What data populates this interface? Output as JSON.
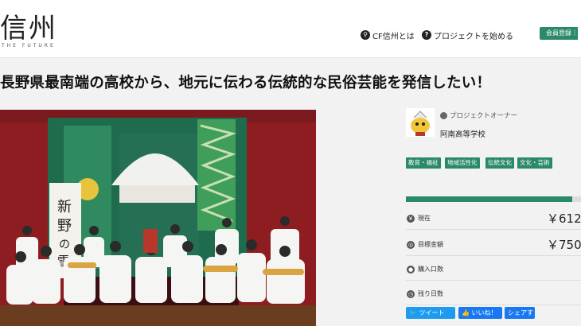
{
  "header": {
    "logo_text": "信州",
    "logo_tagline": "THE FUTURE",
    "nav": [
      {
        "label": "CF信州とは",
        "icon": "search-icon"
      },
      {
        "label": "プロジェクトを始める",
        "icon": "question-icon"
      }
    ],
    "register_label": "会員登録｜"
  },
  "project": {
    "title": "長野県最南端の高校から、地元に伝わる伝統的な民俗芸能を発信したい！",
    "hero_banner_text": "新野の雪ま"
  },
  "owner": {
    "label": "プロジェクトオーナー",
    "name": "阿南高等学校"
  },
  "tags": [
    "教育・福祉",
    "地域活性化",
    "伝統文化",
    "文化・芸術"
  ],
  "progress": {
    "fraction": 0.95
  },
  "stats": [
    {
      "label": "現在",
      "value": "￥612",
      "icon": "yen-icon"
    },
    {
      "label": "目標金額",
      "value": "￥750",
      "icon": "target-icon"
    },
    {
      "label": "購入口数",
      "value": "",
      "icon": "people-icon"
    },
    {
      "label": "残り日数",
      "value": "",
      "icon": "clock-icon"
    }
  ],
  "share": {
    "tweet_label": "ツイート",
    "like_label": "いいね！",
    "share_label": "シェアす"
  },
  "colors": {
    "accent": "#2a8a68",
    "twitter": "#1d9bf0",
    "facebook": "#1877f2"
  }
}
